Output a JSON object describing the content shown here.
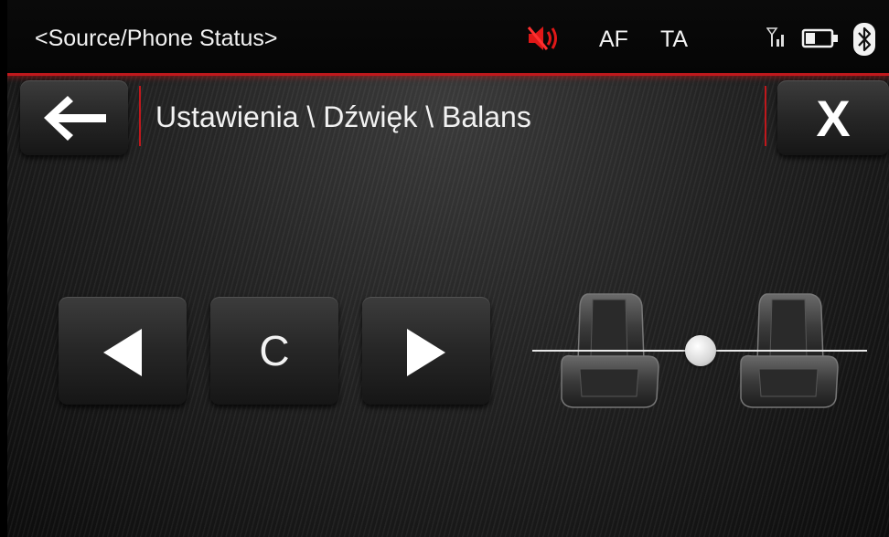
{
  "status_bar": {
    "source_label": "<Source/Phone Status>",
    "af_label": "AF",
    "ta_label": "TA",
    "icons": [
      "speaker-muted-icon",
      "signal-icon",
      "battery-icon",
      "bluetooth-icon"
    ],
    "accent_color": "#c0181c"
  },
  "header": {
    "breadcrumb": "Ustawienia \\ Dźwięk \\ Balans",
    "back_icon": "arrow-left-icon",
    "close_label": "X"
  },
  "controls": {
    "left_icon": "triangle-left-icon",
    "center_label": "C",
    "right_icon": "triangle-right-icon"
  },
  "balance": {
    "position_fraction": 0.5,
    "icons": [
      "seat-left-icon",
      "seat-right-icon"
    ]
  }
}
